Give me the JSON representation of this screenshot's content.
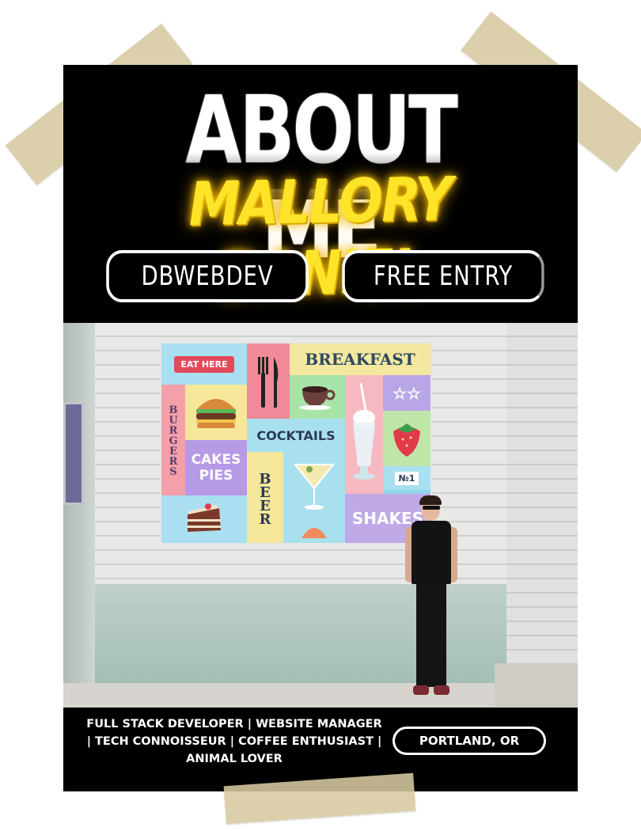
{
  "poster": {
    "title": "ABOUT ME",
    "name": "MALLORY DANIEL",
    "handle_button": "DBWEBDEV",
    "entry_button": "FREE ENTRY",
    "tagline": "FULL STACK DEVELOPER | WEBSITE MANAGER | TECH CONNOISSEUR | COFFEE ENTHUSIAST | ANIMAL LOVER",
    "location": "PORTLAND, OR"
  },
  "mural": {
    "eat_here": "EAT HERE",
    "breakfast": "BREAKFAST",
    "burgers": "BURGERS",
    "cocktails": "COCKTAILS",
    "cakes_pies": "CAKES PIES",
    "beer": "BEER",
    "no1": "№1",
    "shakes": "SHAKES",
    "stars": "☆☆"
  },
  "colors": {
    "background": "#000000",
    "accent_yellow": "#fde428",
    "text": "#ffffff",
    "tape": "#d6c8a0"
  }
}
